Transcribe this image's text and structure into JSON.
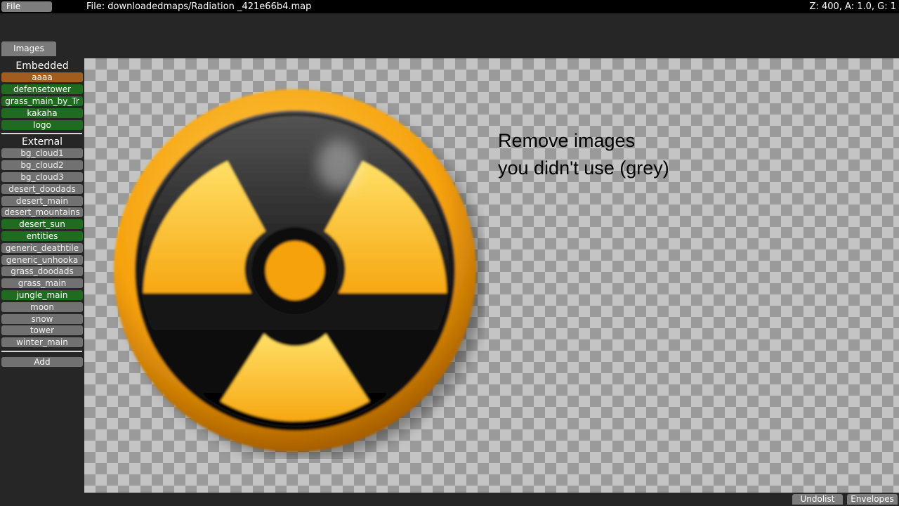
{
  "menu": {
    "file_label": "File"
  },
  "header": {
    "file_path": "File: downloadedmaps/Radiation _421e66b4.map",
    "zoom_readout": "Z: 400, A: 1.0, G: 1"
  },
  "tabs": {
    "images_label": "Images"
  },
  "sidebar": {
    "embedded_title": "Embedded",
    "embedded_items": [
      {
        "label": "aaaa",
        "state": "selected"
      },
      {
        "label": "defensetower",
        "state": "used"
      },
      {
        "label": "grass_main_by_Tr",
        "state": "used"
      },
      {
        "label": "kakaha",
        "state": "used"
      },
      {
        "label": "logo",
        "state": "used"
      }
    ],
    "external_title": "External",
    "external_items": [
      {
        "label": "bg_cloud1",
        "state": "unused"
      },
      {
        "label": "bg_cloud2",
        "state": "unused"
      },
      {
        "label": "bg_cloud3",
        "state": "unused"
      },
      {
        "label": "desert_doodads",
        "state": "unused"
      },
      {
        "label": "desert_main",
        "state": "unused"
      },
      {
        "label": "desert_mountains",
        "state": "unused"
      },
      {
        "label": "desert_sun",
        "state": "used"
      },
      {
        "label": "entities",
        "state": "used"
      },
      {
        "label": "generic_deathtile",
        "state": "unused"
      },
      {
        "label": "generic_unhooka",
        "state": "unused"
      },
      {
        "label": "grass_doodads",
        "state": "unused"
      },
      {
        "label": "grass_main",
        "state": "unused"
      },
      {
        "label": "jungle_main",
        "state": "used"
      },
      {
        "label": "moon",
        "state": "unused"
      },
      {
        "label": "snow",
        "state": "unused"
      },
      {
        "label": "tower",
        "state": "unused"
      },
      {
        "label": "winter_main",
        "state": "unused"
      }
    ],
    "add_label": "Add"
  },
  "canvas": {
    "note_line1": "Remove images",
    "note_line2": "you didn't use (grey)",
    "preview_icon": "radiation-hazard-icon"
  },
  "footer": {
    "undolist_label": "Undolist",
    "envelopes_label": "Envelopes"
  },
  "colors": {
    "selected": "#a15d1d",
    "used": "#1f6b1f",
    "unused": "#717171",
    "hazard_yellow": "#f6a20c"
  }
}
